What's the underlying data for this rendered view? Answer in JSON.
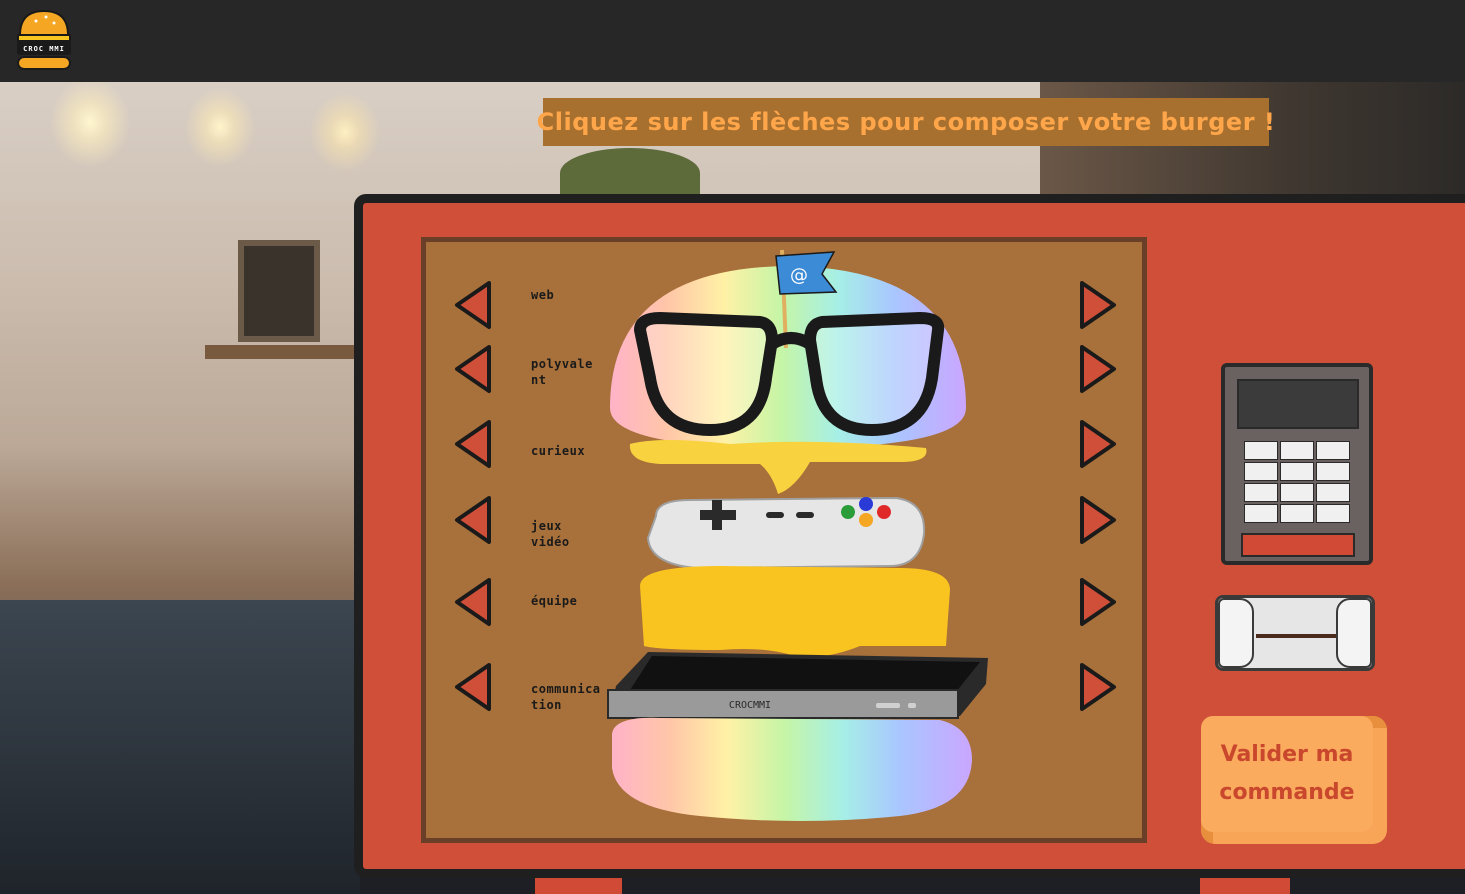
{
  "header": {
    "logo_text": "CROC MMI"
  },
  "banner": {
    "title": "Cliquez sur les flèches pour composer votre burger !"
  },
  "rows": [
    {
      "label": "web"
    },
    {
      "label": "polyvalent"
    },
    {
      "label": "curieux"
    },
    {
      "label": "jeux vidéo"
    },
    {
      "label": "équipe"
    },
    {
      "label": "communication"
    }
  ],
  "burger": {
    "flag_symbol": "@",
    "console_text": "CROCMMI"
  },
  "validate_button": {
    "label": "Valider ma commande"
  },
  "colors": {
    "kiosk_red": "#cf4f39",
    "panel_brown": "#a8703a",
    "banner_brown": "#a8702f",
    "banner_text_orange": "#ffa64a",
    "button_orange": "#f9a557",
    "header_dark": "#272727"
  },
  "icons": {
    "left_arrow": "arrow-left-icon",
    "right_arrow": "arrow-right-icon"
  }
}
